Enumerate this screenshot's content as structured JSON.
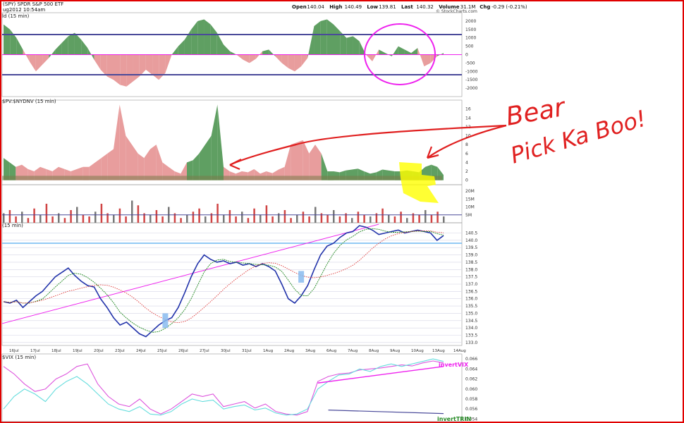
{
  "header": {
    "title": "(SPY) SPDR S&P 500 ETF",
    "timestamp": "ug2012 10:54am",
    "quote_labels": [
      "Open",
      "High",
      "Low",
      "Last",
      "Volume",
      "Chg"
    ],
    "quote_values": [
      "140.04",
      "140.49",
      "139.81",
      "140.32",
      "31.1M",
      "-0.29 (-0.21%)"
    ],
    "watermark": "© StockCharts.com"
  },
  "panels": {
    "tick": {
      "label": "ld (15 min)"
    },
    "upvol": {
      "label": "$PV:$NYDNV (15 min)"
    },
    "price": {
      "label": "(15 min)"
    },
    "vix": {
      "label": "$VIX (15 min)"
    }
  },
  "annotation": {
    "line1": "Bear",
    "line2": "Pick Ka Boo!"
  },
  "colors": {
    "green_fill": "#5f9f62",
    "red_fill": "#e89d9d",
    "navy": "#4a4a9a",
    "magenta": "#ee22ee",
    "ink_red": "#e02020",
    "highlight": "#ffff00",
    "price_cyan": "#55aaee",
    "sma_green": "#228822",
    "sma_red": "#dd3333",
    "cyan": "#66dddd",
    "vix_magenta": "#dd55dd"
  },
  "chart_data": [
    {
      "type": "area",
      "id": "tick",
      "ylim": [
        -2500,
        2500
      ],
      "y_ticks": [
        2000,
        1500,
        1000,
        500,
        0,
        -500,
        -1000,
        -1500,
        -2000
      ],
      "y_tick_labels": [
        "2000",
        "1500",
        "1000",
        "500",
        "0",
        "-500",
        "-1000",
        "-1500",
        "-2000"
      ],
      "reference_lines": [
        1200,
        -1200
      ],
      "values": [
        1800,
        1500,
        1000,
        300,
        -400,
        -1000,
        -600,
        -200,
        300,
        700,
        1100,
        1300,
        900,
        400,
        -300,
        -900,
        -1300,
        -1500,
        -1800,
        -1900,
        -1600,
        -1300,
        -900,
        -1200,
        -1500,
        -1100,
        0,
        500,
        900,
        1500,
        2000,
        2100,
        1800,
        1300,
        600,
        200,
        0,
        -300,
        -500,
        -250,
        200,
        300,
        -100,
        -500,
        -800,
        -1000,
        -700,
        -200,
        1700,
        2000,
        2100,
        1800,
        1400,
        1000,
        1100,
        800,
        0,
        -400,
        300,
        100,
        -100,
        500,
        300,
        100,
        400,
        -700,
        -500,
        -100,
        100
      ]
    },
    {
      "type": "area",
      "id": "upvol",
      "ylim": [
        -1,
        18
      ],
      "y_ticks": [
        16,
        14,
        12,
        10,
        8,
        6,
        4,
        2,
        0
      ],
      "y_tick_labels": [
        "16",
        "14",
        "12",
        "10",
        "8",
        "6",
        "4",
        "2",
        "0"
      ],
      "values": [
        5,
        4,
        3,
        3.5,
        2.5,
        2,
        3,
        2.5,
        2,
        3,
        2.5,
        2,
        2.5,
        3,
        3,
        4,
        5,
        6,
        7,
        17,
        10,
        8,
        6,
        5,
        7,
        8,
        4,
        3,
        2,
        1.5,
        4,
        4.5,
        6,
        8,
        10,
        17,
        3,
        2,
        1.5,
        2,
        1.8,
        2.5,
        1.5,
        2,
        1.6,
        2.4,
        3,
        8,
        8.5,
        9,
        6,
        8,
        6,
        2,
        2,
        1.8,
        2.2,
        2.4,
        2.6,
        2,
        1.5,
        1.8,
        2.4,
        2.2,
        2,
        2,
        2.2,
        2,
        1.8,
        3,
        3.5,
        3,
        1.2
      ],
      "colors": [
        "g",
        "g",
        "r",
        "r",
        "r",
        "r",
        "r",
        "r",
        "r",
        "r",
        "r",
        "r",
        "r",
        "r",
        "r",
        "r",
        "r",
        "r",
        "r",
        "r",
        "r",
        "r",
        "r",
        "r",
        "r",
        "r",
        "r",
        "r",
        "r",
        "r",
        "g",
        "g",
        "g",
        "g",
        "g",
        "g",
        "r",
        "r",
        "r",
        "r",
        "r",
        "r",
        "r",
        "r",
        "r",
        "r",
        "r",
        "r",
        "r",
        "r",
        "r",
        "r",
        "g",
        "g",
        "g",
        "g",
        "g",
        "g",
        "g",
        "g",
        "g",
        "g",
        "g",
        "g",
        "g",
        "g",
        "g",
        "g",
        "g",
        "g",
        "g",
        "g",
        "g"
      ]
    },
    {
      "type": "bar",
      "id": "volume",
      "ylim": [
        0,
        24
      ],
      "y_ticks": [
        20,
        15,
        10,
        5
      ],
      "y_tick_labels": [
        "20M",
        "15M",
        "10M",
        "5M"
      ],
      "reference_lines": [
        5
      ],
      "values": [
        6,
        8,
        4,
        7,
        3,
        9,
        5,
        12,
        4,
        6,
        3,
        8,
        10,
        5,
        4,
        7,
        12,
        6,
        5,
        9,
        4,
        14,
        11,
        6,
        5,
        8,
        4,
        10,
        6,
        3,
        5,
        7,
        9,
        4,
        6,
        12,
        5,
        8,
        4,
        7,
        3,
        9,
        5,
        11,
        4,
        6,
        8,
        3,
        5,
        7,
        4,
        10,
        6,
        5,
        8,
        4,
        6,
        3,
        7,
        5,
        4,
        6,
        9,
        5,
        4,
        7,
        3,
        6,
        5,
        8,
        5,
        7,
        4
      ]
    },
    {
      "type": "line",
      "id": "price",
      "ylim": [
        132.8,
        141.2
      ],
      "y_ticks": [
        140.5,
        140.0,
        139.5,
        139.0,
        138.5,
        138.0,
        137.5,
        137.0,
        136.5,
        136.0,
        135.5,
        135.0,
        134.5,
        134.0,
        133.5,
        133.0
      ],
      "y_tick_labels": [
        "140.5",
        "140.0",
        "139.5",
        "139.0",
        "138.5",
        "138.0",
        "137.5",
        "137.0",
        "136.5",
        "136.0",
        "135.5",
        "135.0",
        "134.5",
        "134.0",
        "133.5",
        "133.0"
      ],
      "x_labels": [
        "16Jul",
        "17Jul",
        "18Jul",
        "19Jul",
        "20Jul",
        "23Jul",
        "24Jul",
        "25Jul",
        "26Jul",
        "27Jul",
        "30Jul",
        "31Jul",
        "1Aug",
        "2Aug",
        "3Aug",
        "6Aug",
        "7Aug",
        "8Aug",
        "9Aug",
        "10Aug",
        "13Aug",
        "14Aug"
      ],
      "reference_lines": [
        139.8
      ],
      "values": [
        135.8,
        135.7,
        135.9,
        135.4,
        135.8,
        136.2,
        136.5,
        137.0,
        137.5,
        137.8,
        138.1,
        137.6,
        137.2,
        136.9,
        136.8,
        136.0,
        135.4,
        134.7,
        134.2,
        134.4,
        134.0,
        133.6,
        133.4,
        133.8,
        134.2,
        134.5,
        134.7,
        135.4,
        136.4,
        137.5,
        138.4,
        139.0,
        138.7,
        138.5,
        138.6,
        138.4,
        138.5,
        138.3,
        138.4,
        138.2,
        138.4,
        138.2,
        137.9,
        137.0,
        136.0,
        135.7,
        136.2,
        136.9,
        138.0,
        139.0,
        139.6,
        139.8,
        140.2,
        140.5,
        140.6,
        141.0,
        140.9,
        140.7,
        140.4,
        140.5,
        140.6,
        140.7,
        140.5,
        140.6,
        140.7,
        140.6,
        140.5,
        140.0,
        140.32
      ]
    },
    {
      "type": "line",
      "id": "vix",
      "ylim": [
        0.0535,
        0.067
      ],
      "y_ticks": [
        0.066,
        0.064,
        0.062,
        0.06,
        0.058,
        0.056,
        0.054
      ],
      "y_tick_labels": [
        "0.066",
        "0.064",
        "0.062",
        "0.060",
        "0.058",
        "0.056",
        "0.054"
      ],
      "series": [
        {
          "name": "invertVIX",
          "values": [
            0.0645,
            0.063,
            0.061,
            0.0595,
            0.06,
            0.062,
            0.063,
            0.0645,
            0.065,
            0.061,
            0.0585,
            0.057,
            0.0565,
            0.058,
            0.056,
            0.055,
            0.056,
            0.0575,
            0.059,
            0.0585,
            0.059,
            0.0565,
            0.057,
            0.0575,
            0.0562,
            0.057,
            0.0555,
            0.055,
            0.0548,
            0.0555,
            0.0615,
            0.0625,
            0.063,
            0.0632,
            0.0638,
            0.064,
            0.0642,
            0.0645,
            0.0648,
            0.0646,
            0.0652,
            0.0656,
            0.0652
          ]
        },
        {
          "name": "invertTRIN",
          "values": [
            0.056,
            0.0585,
            0.06,
            0.059,
            0.0575,
            0.06,
            0.0615,
            0.0625,
            0.061,
            0.059,
            0.057,
            0.056,
            0.0555,
            0.0565,
            0.055,
            0.0548,
            0.0555,
            0.057,
            0.058,
            0.0575,
            0.0578,
            0.056,
            0.0565,
            0.0568,
            0.0558,
            0.0562,
            0.0552,
            0.0548,
            0.055,
            0.056,
            0.06,
            0.0615,
            0.0628,
            0.063,
            0.064,
            0.0635,
            0.0645,
            0.065,
            0.0645,
            0.065,
            0.0655,
            0.066,
            0.0655
          ]
        }
      ]
    }
  ]
}
